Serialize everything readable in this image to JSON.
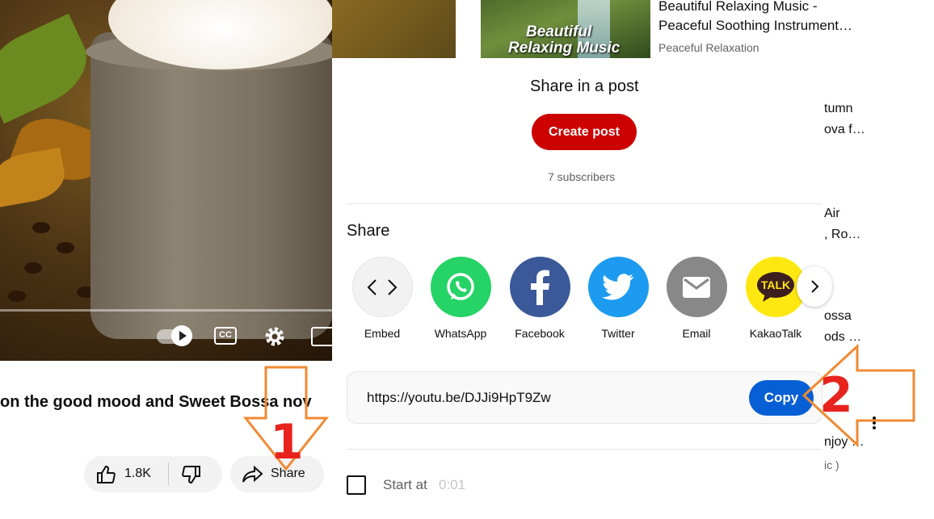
{
  "video": {
    "title_visible": "on the good mood and Sweet Bossa nov",
    "like_count": "1.8K",
    "share_label": "Share"
  },
  "recommendations": {
    "first": {
      "thumb_text_line1": "Beautiful",
      "thumb_text_line2": "Relaxing Music",
      "title_line1": "Beautiful Relaxing Music -",
      "title_line2": "Peaceful Soothing Instrument…",
      "channel": "Peaceful Relaxation"
    },
    "peeks": [
      "tumn",
      "ova f…",
      "Air",
      ", Ro…",
      "ossa",
      "ods …",
      "njoy …",
      "ic )"
    ]
  },
  "share_dialog": {
    "post_heading": "Share in a post",
    "create_post_label": "Create post",
    "subscribers": "7 subscribers",
    "share_heading": "Share",
    "targets": [
      {
        "label": "Embed",
        "icon": "embed-icon",
        "color": "#f2f2f2"
      },
      {
        "label": "WhatsApp",
        "icon": "whatsapp-icon",
        "color": "#25d366"
      },
      {
        "label": "Facebook",
        "icon": "facebook-icon",
        "color": "#3b5998"
      },
      {
        "label": "Twitter",
        "icon": "twitter-icon",
        "color": "#1d9bf0"
      },
      {
        "label": "Email",
        "icon": "email-icon",
        "color": "#888888"
      },
      {
        "label": "KakaoTalk",
        "icon": "kakaotalk-icon",
        "color": "#ffe812"
      }
    ],
    "next_icon": "chevron-right-icon",
    "url": "https://youtu.be/DJJi9HpT9Zw",
    "copy_label": "Copy",
    "start_at_label": "Start at",
    "start_at_time": "0:01"
  },
  "annotations": {
    "step1": "1",
    "step2": "2",
    "arrow_color": "#f08a33"
  },
  "colors": {
    "youtube_red": "#cc0000",
    "copy_blue": "#065fd4"
  }
}
